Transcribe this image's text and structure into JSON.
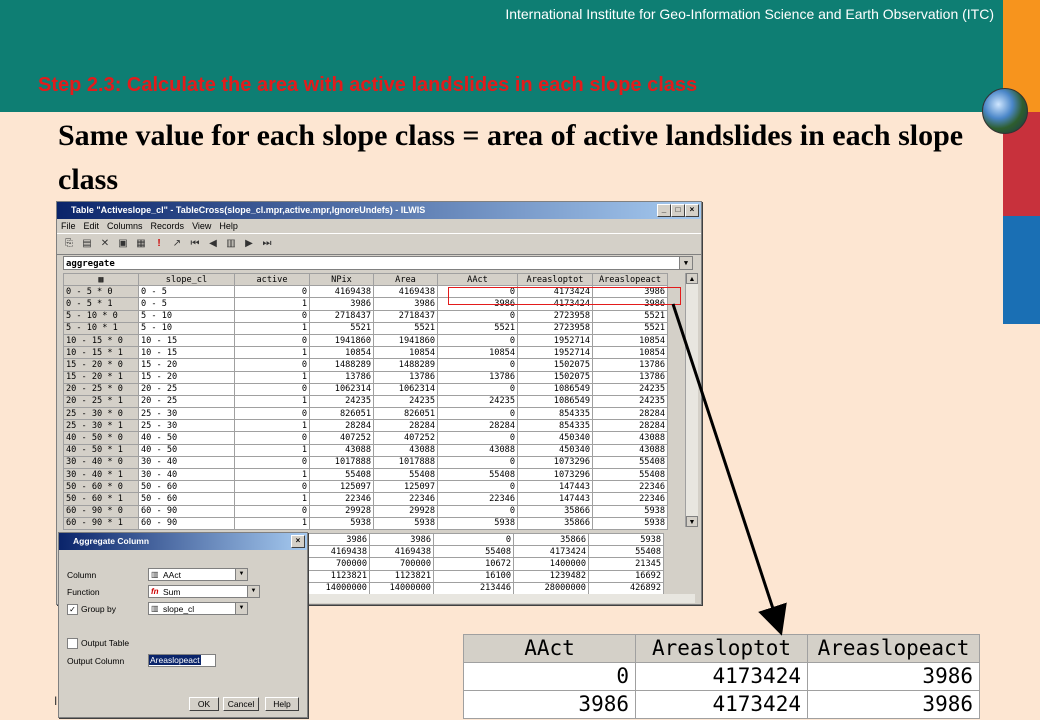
{
  "header": {
    "org": "International Institute for Geo-Information Science and Earth Observation (ITC)",
    "step": "Step 2.3: Calculate the area with active landslides in each slope class",
    "heading": "Same value for each slope class = area of active landslides in each slope class"
  },
  "colors": {
    "header_bg": "#0e7e73",
    "step_text": "#e31b1b",
    "orange": "#f7941d",
    "red": "#c8313c",
    "blue": "#1a6fb4",
    "page_bg": "#fde6d2"
  },
  "window": {
    "title": "Table \"Activeslope_cl\" - TableCross(slope_cl.mpr,active.mpr,IgnoreUndefs) - ILWIS",
    "menu": [
      "File",
      "Edit",
      "Columns",
      "Records",
      "View",
      "Help"
    ],
    "command": "aggregate",
    "columns": [
      "slope_cl",
      "active",
      "NPix",
      "Area",
      "AAct",
      "Areasloptot",
      "Areaslopeact"
    ],
    "rows": [
      [
        "0 - 5 * 0",
        "0 - 5",
        "0",
        "4169438",
        "4169438",
        "0",
        "4173424",
        "3986"
      ],
      [
        "0 - 5 * 1",
        "0 - 5",
        "1",
        "3986",
        "3986",
        "3986",
        "4173424",
        "3986"
      ],
      [
        "5 - 10 * 0",
        "5 - 10",
        "0",
        "2718437",
        "2718437",
        "0",
        "2723958",
        "5521"
      ],
      [
        "5 - 10 * 1",
        "5 - 10",
        "1",
        "5521",
        "5521",
        "5521",
        "2723958",
        "5521"
      ],
      [
        "10 - 15 * 0",
        "10 - 15",
        "0",
        "1941860",
        "1941860",
        "0",
        "1952714",
        "10854"
      ],
      [
        "10 - 15 * 1",
        "10 - 15",
        "1",
        "10854",
        "10854",
        "10854",
        "1952714",
        "10854"
      ],
      [
        "15 - 20 * 0",
        "15 - 20",
        "0",
        "1488289",
        "1488289",
        "0",
        "1502075",
        "13786"
      ],
      [
        "15 - 20 * 1",
        "15 - 20",
        "1",
        "13786",
        "13786",
        "13786",
        "1502075",
        "13786"
      ],
      [
        "20 - 25 * 0",
        "20 - 25",
        "0",
        "1062314",
        "1062314",
        "0",
        "1086549",
        "24235"
      ],
      [
        "20 - 25 * 1",
        "20 - 25",
        "1",
        "24235",
        "24235",
        "24235",
        "1086549",
        "24235"
      ],
      [
        "25 - 30 * 0",
        "25 - 30",
        "0",
        "826051",
        "826051",
        "0",
        "854335",
        "28284"
      ],
      [
        "25 - 30 * 1",
        "25 - 30",
        "1",
        "28284",
        "28284",
        "28284",
        "854335",
        "28284"
      ],
      [
        "40 - 50 * 0",
        "40 - 50",
        "0",
        "407252",
        "407252",
        "0",
        "450340",
        "43088"
      ],
      [
        "40 - 50 * 1",
        "40 - 50",
        "1",
        "43088",
        "43088",
        "43088",
        "450340",
        "43088"
      ],
      [
        "30 - 40 * 0",
        "30 - 40",
        "0",
        "1017888",
        "1017888",
        "0",
        "1073296",
        "55408"
      ],
      [
        "30 - 40 * 1",
        "30 - 40",
        "1",
        "55408",
        "55408",
        "55408",
        "1073296",
        "55408"
      ],
      [
        "50 - 60 * 0",
        "50 - 60",
        "0",
        "125097",
        "125097",
        "0",
        "147443",
        "22346"
      ],
      [
        "50 - 60 * 1",
        "50 - 60",
        "1",
        "22346",
        "22346",
        "22346",
        "147443",
        "22346"
      ],
      [
        "60 - 90 * 0",
        "60 - 90",
        "0",
        "29928",
        "29928",
        "0",
        "35866",
        "5938"
      ],
      [
        "60 - 90 * 1",
        "60 - 90",
        "1",
        "5938",
        "5938",
        "5938",
        "35866",
        "5938"
      ]
    ],
    "stats": [
      [
        "3986",
        "3986",
        "0",
        "35866",
        "5938"
      ],
      [
        "4169438",
        "4169438",
        "55408",
        "4173424",
        "55408"
      ],
      [
        "700000",
        "700000",
        "10672",
        "1400000",
        "21345"
      ],
      [
        "1123821",
        "1123821",
        "16100",
        "1239482",
        "16692"
      ],
      [
        "14000000",
        "14000000",
        "213446",
        "28000000",
        "426892"
      ]
    ]
  },
  "dialog": {
    "title": "Aggregate Column",
    "column_label": "Column",
    "column_value": "AAct",
    "function_label": "Function",
    "function_value": "Sum",
    "group_by_label": "Group by",
    "group_by_value": "slope_cl",
    "output_table_label": "Output Table",
    "output_column_label": "Output Column",
    "output_column_value": "Areaslopeact",
    "ok": "OK",
    "cancel": "Cancel",
    "help": "Help"
  },
  "zoom": {
    "columns": [
      "AAct",
      "Areasloptot",
      "Areaslopeact"
    ],
    "rows": [
      [
        "0",
        "4173424",
        "3986"
      ],
      [
        "3986",
        "4173424",
        "3986"
      ]
    ]
  },
  "footer_mark": "I"
}
